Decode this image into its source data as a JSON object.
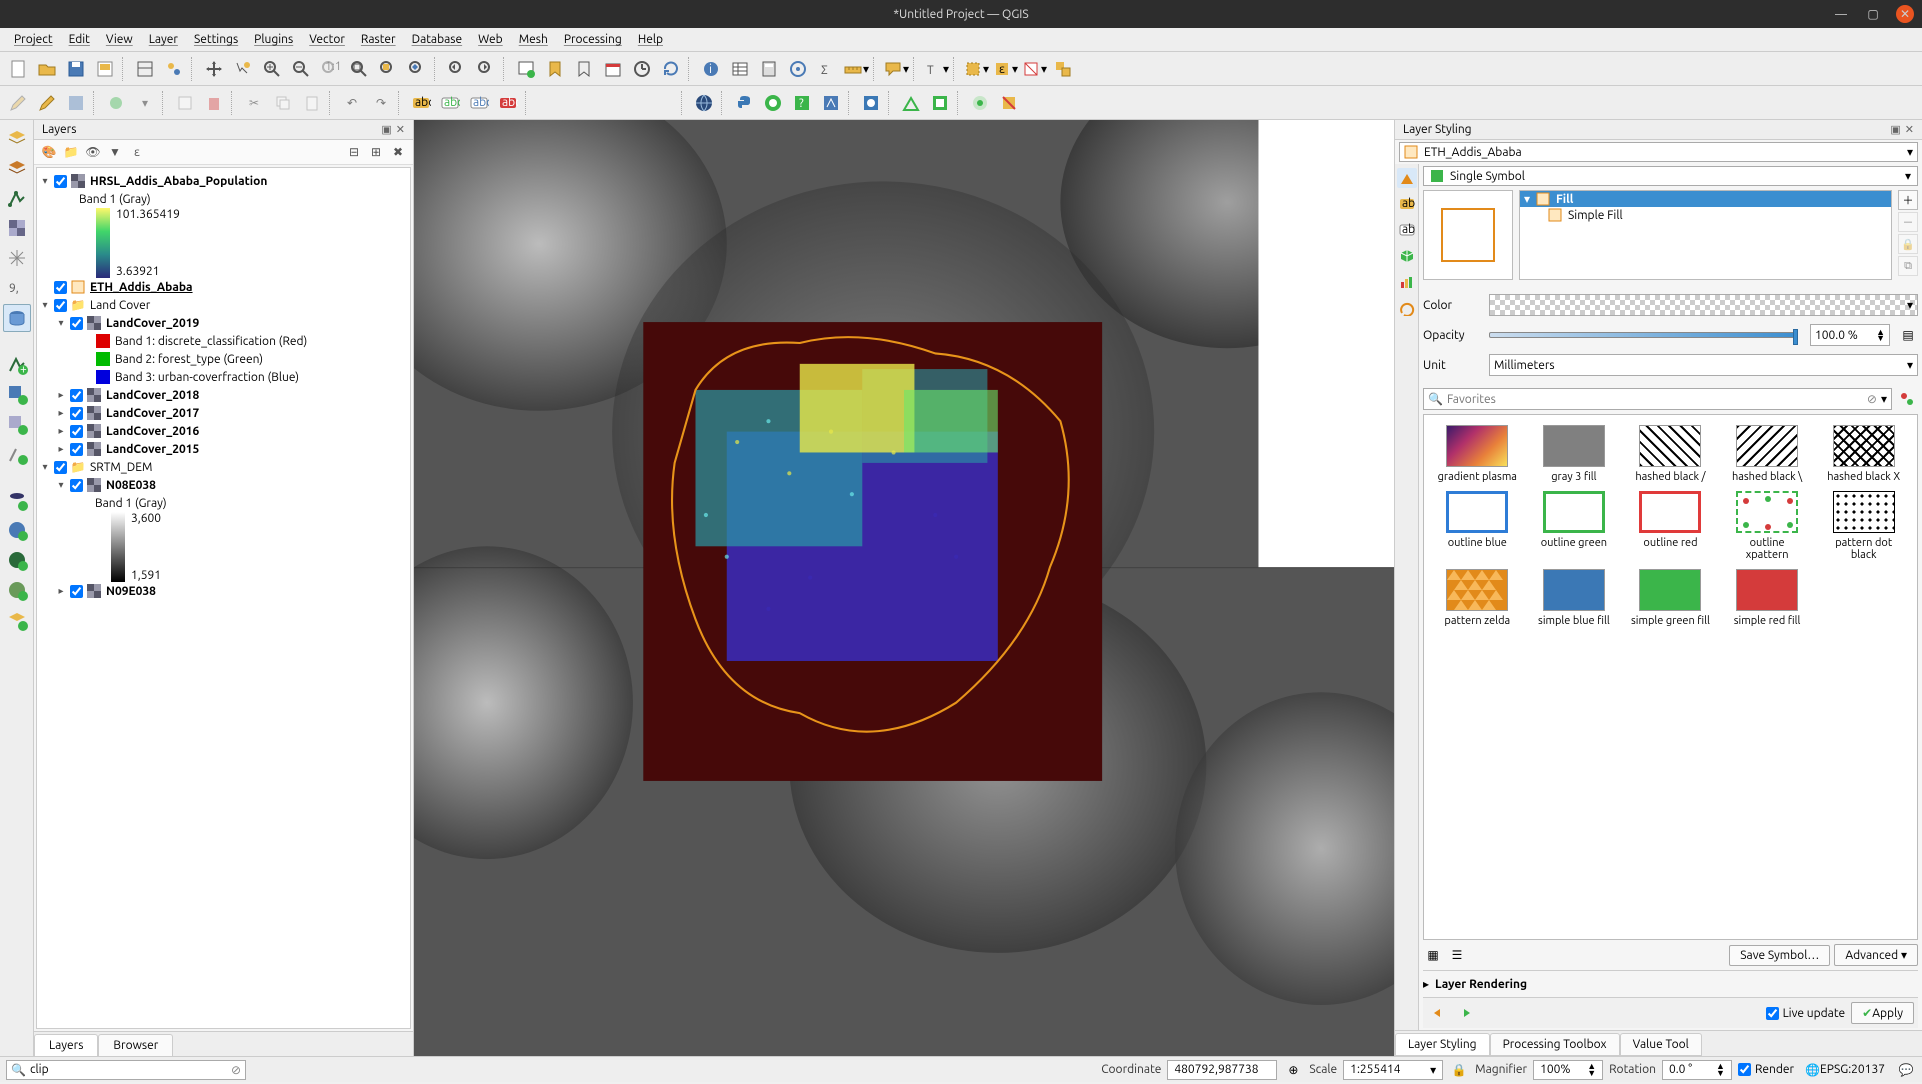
{
  "window": {
    "title": "*Untitled Project — QGIS"
  },
  "menu": [
    "Project",
    "Edit",
    "View",
    "Layer",
    "Settings",
    "Plugins",
    "Vector",
    "Raster",
    "Database",
    "Web",
    "Mesh",
    "Processing",
    "Help"
  ],
  "panels": {
    "layers_title": "Layers",
    "layer_styling_title": "Layer Styling",
    "layers_tab": "Layers",
    "browser_tab": "Browser"
  },
  "layers": {
    "hrsl": {
      "name": "HRSL_Addis_Ababa_Population",
      "band": "Band 1 (Gray)",
      "max": "101.365419",
      "min": "3.63921"
    },
    "eth": {
      "name": "ETH_Addis_Ababa"
    },
    "landcover_group": "Land Cover",
    "lc2019": {
      "name": "LandCover_2019",
      "b1": "Band 1: discrete_classification (Red)",
      "b2": "Band 2: forest_type (Green)",
      "b3": "Band 3: urban-coverfraction (Blue)"
    },
    "lc2018": "LandCover_2018",
    "lc2017": "LandCover_2017",
    "lc2016": "LandCover_2016",
    "lc2015": "LandCover_2015",
    "srtm_group": "SRTM_DEM",
    "n08": {
      "name": "N08E038",
      "band": "Band 1 (Gray)",
      "max": "3,600",
      "min": "1,591"
    },
    "n09": "N09E038"
  },
  "styling": {
    "target_layer": "ETH_Addis_Ababa",
    "renderer": "Single Symbol",
    "fill_label": "Fill",
    "simple_fill_label": "Simple Fill",
    "color_label": "Color",
    "opacity_label": "Opacity",
    "opacity_value": "100.0 %",
    "unit_label": "Unit",
    "unit_value": "Millimeters",
    "search_placeholder": "Favorites",
    "save_symbol": "Save Symbol…",
    "advanced": "Advanced",
    "layer_rendering": "Layer Rendering",
    "live_update": "Live update",
    "apply": "Apply",
    "swatches": [
      {
        "name": "gradient plasma",
        "type": "gradient"
      },
      {
        "name": "gray 3 fill",
        "type": "solid",
        "color": "#808080"
      },
      {
        "name": "hashed black /",
        "type": "hatch",
        "dir": "/"
      },
      {
        "name": "hashed black \\",
        "type": "hatch",
        "dir": "\\"
      },
      {
        "name": "hashed black X",
        "type": "hatch",
        "dir": "x"
      },
      {
        "name": "outline blue",
        "type": "outline",
        "color": "#2e7cd6"
      },
      {
        "name": "outline green",
        "type": "outline",
        "color": "#3bb54a"
      },
      {
        "name": "outline red",
        "type": "outline",
        "color": "#e03a3a"
      },
      {
        "name": "outline xpattern",
        "type": "dots-outline"
      },
      {
        "name": "pattern dot black",
        "type": "dots"
      },
      {
        "name": "pattern zelda",
        "type": "zelda"
      },
      {
        "name": "simple blue fill",
        "type": "solid",
        "color": "#3b78b5"
      },
      {
        "name": "simple green fill",
        "type": "solid",
        "color": "#3bb54a"
      },
      {
        "name": "simple red fill",
        "type": "solid",
        "color": "#d43b3b"
      }
    ]
  },
  "right_tabs": [
    "Layer Styling",
    "Processing Toolbox",
    "Value Tool"
  ],
  "status": {
    "locator_value": "clip",
    "coord_label": "Coordinate",
    "coord_value": "480792,987738",
    "scale_label": "Scale",
    "scale_value": "1:255414",
    "magnifier_label": "Magnifier",
    "magnifier_value": "100%",
    "rotation_label": "Rotation",
    "rotation_value": "0.0 °",
    "render_label": "Render",
    "crs": "EPSG:20137"
  }
}
